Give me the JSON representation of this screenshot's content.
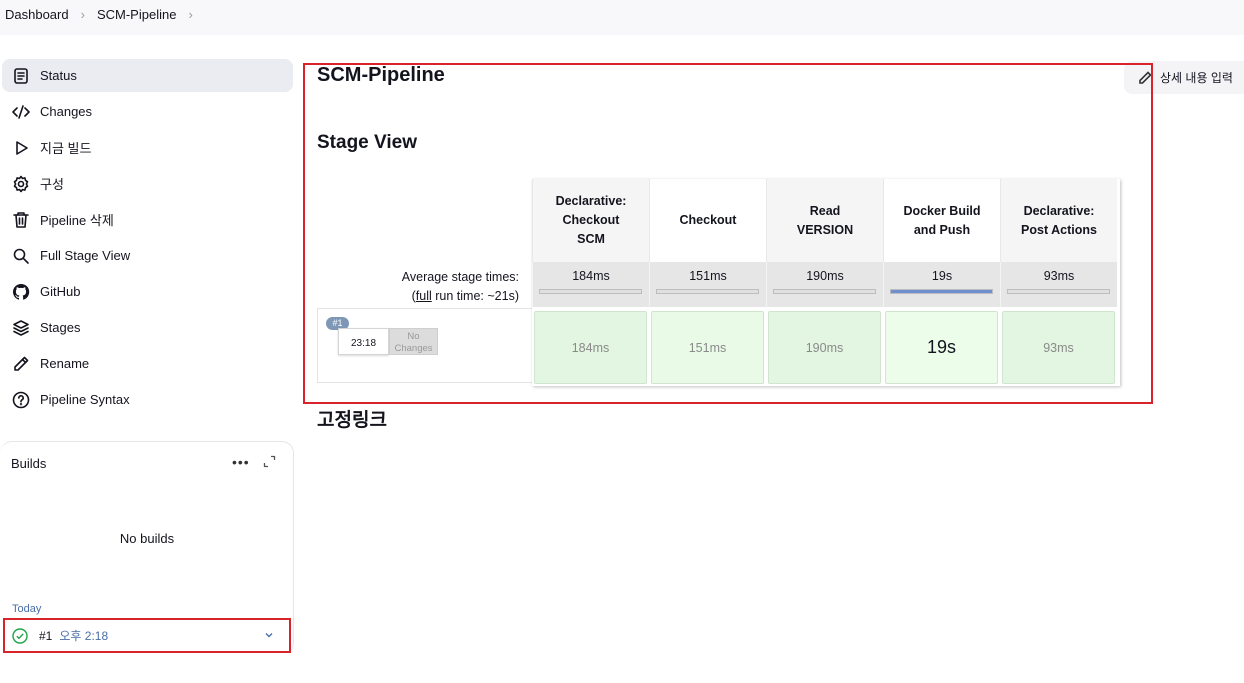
{
  "breadcrumb": {
    "items": [
      "Dashboard",
      "SCM-Pipeline"
    ]
  },
  "sidebar": {
    "items": [
      {
        "label": "Status",
        "icon": "status-icon"
      },
      {
        "label": "Changes",
        "icon": "code-icon"
      },
      {
        "label": "지금 빌드",
        "icon": "play-icon"
      },
      {
        "label": "구성",
        "icon": "gear-icon"
      },
      {
        "label": "Pipeline 삭제",
        "icon": "trash-icon"
      },
      {
        "label": "Full Stage View",
        "icon": "search-icon"
      },
      {
        "label": "GitHub",
        "icon": "github-icon"
      },
      {
        "label": "Stages",
        "icon": "layers-icon"
      },
      {
        "label": "Rename",
        "icon": "pencil-icon"
      },
      {
        "label": "Pipeline Syntax",
        "icon": "help-icon"
      }
    ]
  },
  "builds": {
    "title": "Builds",
    "more": "•••",
    "empty": "No builds",
    "today": "Today",
    "row": {
      "number": "#1",
      "time": "오후 2:18",
      "status": "success"
    }
  },
  "main": {
    "title": "SCM-Pipeline",
    "edit_description": "상세 내용 입력",
    "stage_view_title": "Stage View",
    "permalinks_title": "고정링크"
  },
  "stage_view": {
    "avg_label": "Average stage times:",
    "full_label": "full",
    "run_time_label": "run time: ~21s",
    "run": {
      "badge": "#1",
      "time": "23:18",
      "changes": "No Changes"
    },
    "stages": [
      {
        "name": "Declarative: Checkout SCM",
        "avg": "184ms",
        "cell": "184ms",
        "bar_fraction": 0
      },
      {
        "name": "Checkout",
        "avg": "151ms",
        "cell": "151ms",
        "bar_fraction": 0
      },
      {
        "name": "Read VERSION",
        "avg": "190ms",
        "cell": "190ms",
        "bar_fraction": 0
      },
      {
        "name": "Docker Build and Push",
        "avg": "19s",
        "cell": "19s",
        "bar_fraction": 1
      },
      {
        "name": "Declarative: Post Actions",
        "avg": "93ms",
        "cell": "93ms",
        "bar_fraction": 0
      }
    ]
  },
  "colors": {
    "accent": "#4a6ea8",
    "highlight": "#d9232b",
    "success": "#1ea446"
  }
}
